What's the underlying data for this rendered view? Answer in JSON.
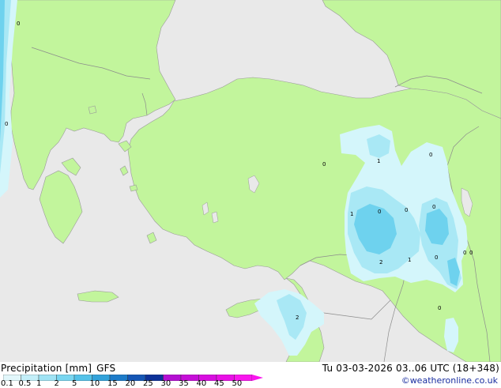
{
  "footer": {
    "title": "Precipitation [mm]",
    "model": "GFS",
    "valid_time": "Tu 03-03-2026 03..06 UTC (18+348)",
    "credit": "©weatheronline.co.uk"
  },
  "legend": {
    "labels": [
      "0.1",
      "0.5",
      "1",
      "2",
      "5",
      "10",
      "15",
      "20",
      "25",
      "30",
      "35",
      "40",
      "45",
      "50"
    ],
    "colors": [
      "#e2f7fb",
      "#c3eef8",
      "#9fe3f4",
      "#79d6f0",
      "#54c2e8",
      "#32a2da",
      "#1d7bc9",
      "#1556b5",
      "#0d3198",
      "#b40fd2",
      "#c60ed8",
      "#d80ee0",
      "#e910e6",
      "#f916ee"
    ]
  },
  "map": {
    "colors": {
      "sea": "#e9e9e9",
      "land": "#c2f59c",
      "border": "#999999",
      "precip_light": "#d4f6fb",
      "precip_mid": "#a9e8f5",
      "precip_strong": "#6ed2ee"
    },
    "values": [
      "0",
      "0",
      "1",
      "0",
      "1",
      "0",
      "0",
      "0",
      "2",
      "1",
      "0",
      "0",
      "0",
      "2",
      "0",
      "0"
    ]
  }
}
